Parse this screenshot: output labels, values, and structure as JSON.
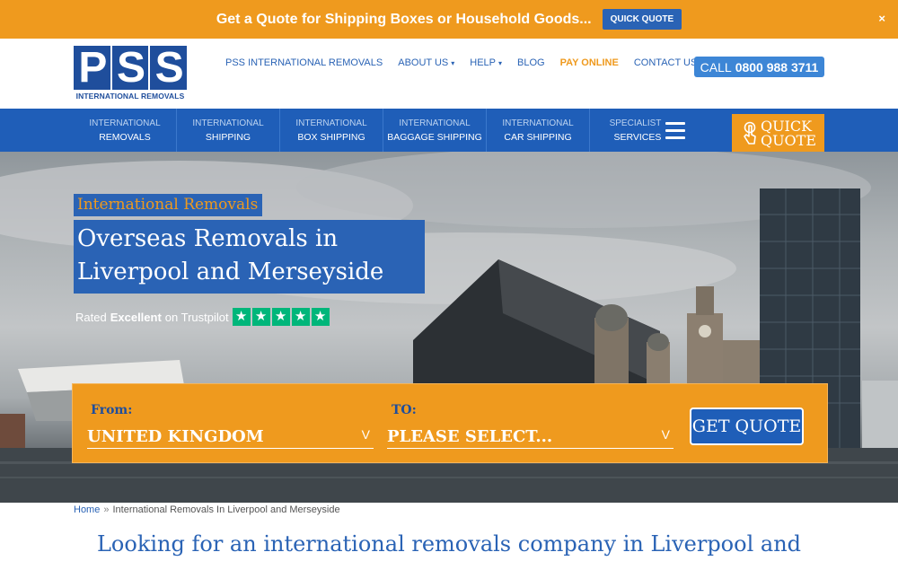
{
  "promo": {
    "text": "Get a Quote for Shipping Boxes or Household Goods...",
    "button": "QUICK QUOTE",
    "close": "×"
  },
  "logo": {
    "letters": [
      "P",
      "S",
      "S"
    ],
    "subtitle": "INTERNATIONAL REMOVALS"
  },
  "topnav": {
    "items": [
      {
        "label": "PSS INTERNATIONAL REMOVALS"
      },
      {
        "label": "ABOUT US",
        "dropdown": true
      },
      {
        "label": "HELP",
        "dropdown": true
      },
      {
        "label": "BLOG"
      },
      {
        "label": "PAY ONLINE",
        "highlight": true
      },
      {
        "label": "CONTACT US"
      }
    ],
    "caret": "▾"
  },
  "call": {
    "label": "CALL",
    "number": "0800 988 3711"
  },
  "mainnav": {
    "items": [
      {
        "line1": "INTERNATIONAL",
        "line2": "REMOVALS"
      },
      {
        "line1": "INTERNATIONAL",
        "line2": "SHIPPING"
      },
      {
        "line1": "INTERNATIONAL",
        "line2": "BOX SHIPPING"
      },
      {
        "line1": "INTERNATIONAL",
        "line2": "BAGGAGE SHIPPING"
      },
      {
        "line1": "INTERNATIONAL",
        "line2": "CAR SHIPPING"
      }
    ],
    "specialist": {
      "line1": "SPECIALIST",
      "line2": "SERVICES"
    },
    "quick_quote": {
      "line1": "QUICK",
      "line2": "QUOTE"
    }
  },
  "hero": {
    "tag": "International Removals",
    "headline_line1": "Overseas Removals in",
    "headline_line2": "Liverpool and Merseyside",
    "trust": {
      "prefix": "Rated",
      "rating": "Excellent",
      "suffix": "on Trustpilot",
      "stars": 5,
      "star_glyph": "★"
    }
  },
  "quote_form": {
    "from_label": "From:",
    "from_value": "UNITED KINGDOM",
    "to_label": "TO:",
    "to_value": "PLEASE SELECT...",
    "caret": "v",
    "button": "GET QUOTE"
  },
  "breadcrumb": {
    "home": "Home",
    "separator": "»",
    "current": "International Removals In Liverpool and Merseyside"
  },
  "intro": {
    "heading": "Looking for an international removals company in Liverpool and"
  },
  "colors": {
    "orange": "#ef9a1e",
    "blue": "#2a63b5",
    "nav_blue": "#1f5eb8",
    "logo_blue": "#1f4e9c",
    "trustpilot_green": "#00b67a"
  }
}
